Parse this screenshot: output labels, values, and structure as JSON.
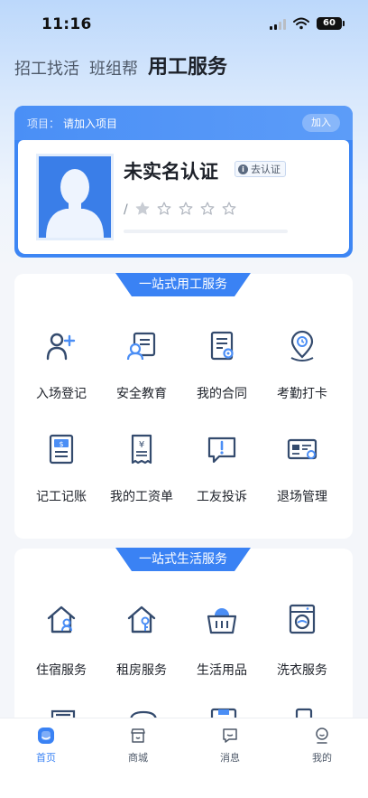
{
  "status_bar": {
    "time": "11:16",
    "battery": "60"
  },
  "top_tabs": [
    {
      "label": "招工找活",
      "active": false
    },
    {
      "label": "班组帮",
      "active": false
    },
    {
      "label": "用工服务",
      "active": true
    }
  ],
  "project_card": {
    "project_label": "项目：",
    "project_value": "请加入项目",
    "join_label": "加入",
    "name": "未实名认证",
    "verify_label": "去认证",
    "role_slash": "/",
    "rating": 1,
    "rating_max": 5
  },
  "employment_section": {
    "title": "一站式用工服务",
    "items": [
      {
        "label": "入场登记",
        "icon": "person-add-icon"
      },
      {
        "label": "安全教育",
        "icon": "safety-education-icon"
      },
      {
        "label": "我的合同",
        "icon": "contract-icon"
      },
      {
        "label": "考勤打卡",
        "icon": "attendance-location-icon"
      },
      {
        "label": "记工记账",
        "icon": "accounting-icon"
      },
      {
        "label": "我的工资单",
        "icon": "payslip-icon"
      },
      {
        "label": "工友投诉",
        "icon": "complaint-icon"
      },
      {
        "label": "退场管理",
        "icon": "exit-management-icon"
      }
    ]
  },
  "life_section": {
    "title": "一站式生活服务",
    "items": [
      {
        "label": "住宿服务",
        "icon": "accommodation-icon"
      },
      {
        "label": "租房服务",
        "icon": "rental-icon"
      },
      {
        "label": "生活用品",
        "icon": "shopping-basket-icon"
      },
      {
        "label": "洗衣服务",
        "icon": "washing-machine-icon"
      }
    ]
  },
  "bottom_nav": [
    {
      "label": "首页",
      "icon": "home-icon",
      "active": true
    },
    {
      "label": "商城",
      "icon": "store-icon",
      "active": false
    },
    {
      "label": "消息",
      "icon": "message-icon",
      "active": false
    },
    {
      "label": "我的",
      "icon": "profile-icon",
      "active": false
    }
  ],
  "colors": {
    "accent": "#3a82f4",
    "icon_dark": "#344b6e",
    "icon_accent": "#4b8ef5"
  }
}
